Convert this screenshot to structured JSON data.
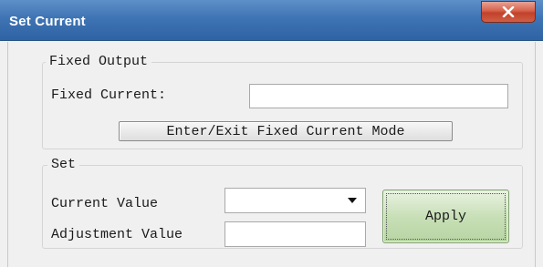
{
  "window": {
    "title": "Set Current",
    "close_icon": "close-x-icon"
  },
  "fixed_output": {
    "legend": "Fixed Output",
    "fixed_current_label": "Fixed Current:",
    "fixed_current_value": "",
    "mode_button_label": "Enter/Exit Fixed Current Mode"
  },
  "set": {
    "legend": "Set",
    "current_value_label": "Current Value",
    "current_value_selected": "",
    "dropdown_icon": "chevron-down-icon",
    "adjustment_value_label": "Adjustment Value",
    "adjustment_value": "",
    "apply_label": "Apply"
  },
  "colors": {
    "titlebar": "#3f74b4",
    "close_button": "#c2412b",
    "apply_button": "#c8dfb7",
    "window_bg": "#f0f0f0"
  }
}
